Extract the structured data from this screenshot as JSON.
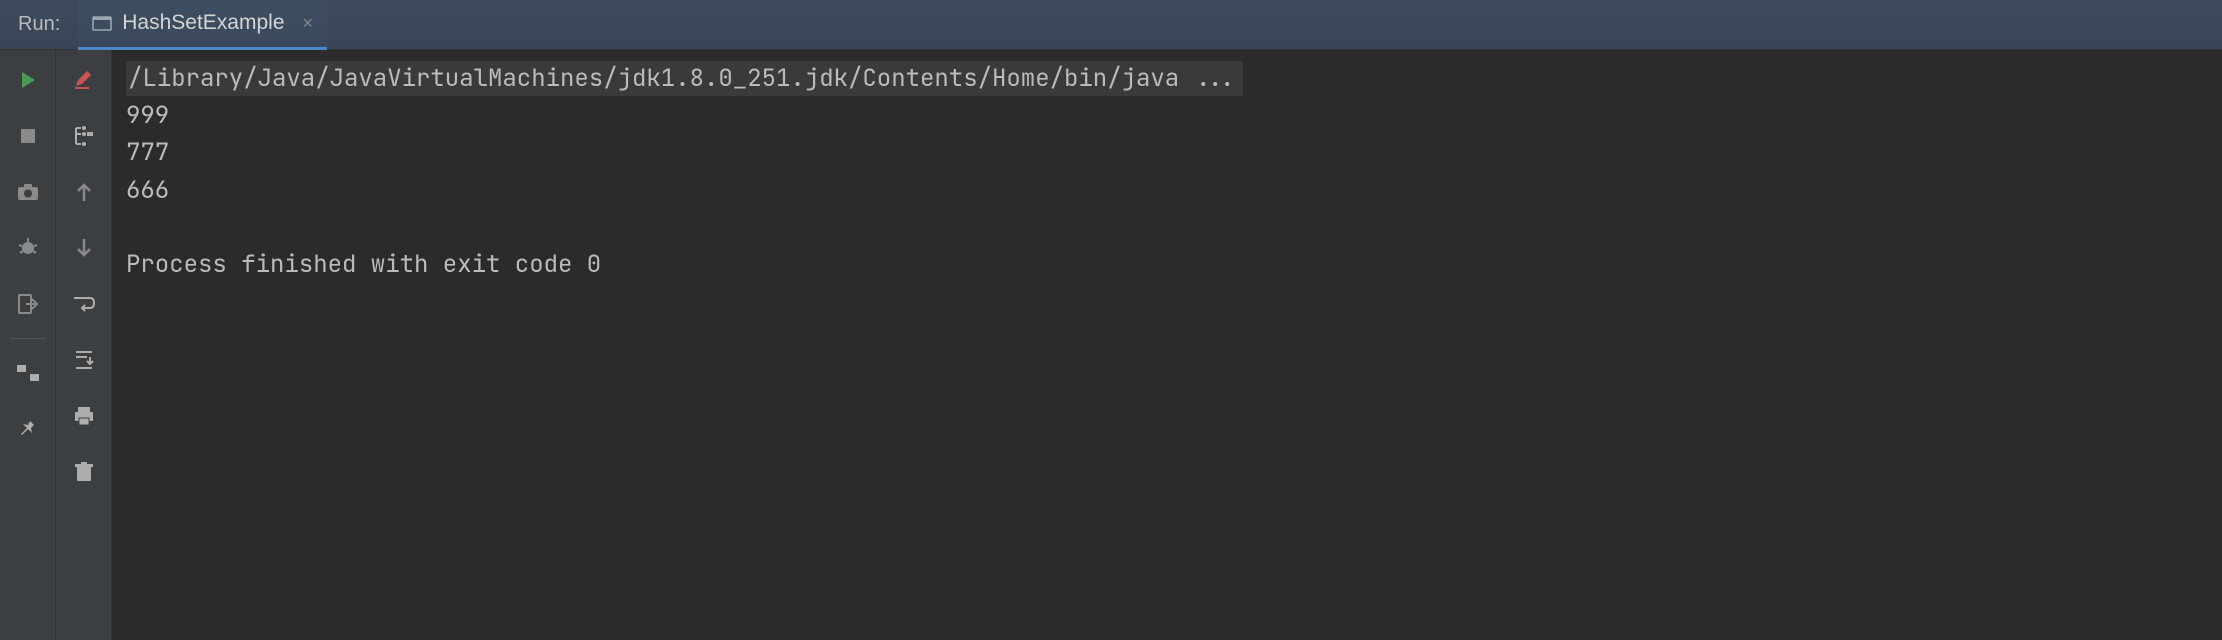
{
  "header": {
    "run_label": "Run:",
    "tab": {
      "title": "HashSetExample",
      "close_glyph": "×"
    }
  },
  "console": {
    "command": "/Library/Java/JavaVirtualMachines/jdk1.8.0_251.jdk/Contents/Home/bin/java ...",
    "output_lines": [
      "999",
      "777",
      "666"
    ],
    "exit_message": "Process finished with exit code 0"
  },
  "icons": {
    "left_gutter": [
      "run",
      "stop",
      "camera",
      "debug",
      "exit",
      "layout",
      "pin"
    ],
    "right_gutter": [
      "edit-pen",
      "step-tree",
      "arrow-up",
      "arrow-down",
      "wrap",
      "scroll-down",
      "print",
      "trash"
    ]
  }
}
